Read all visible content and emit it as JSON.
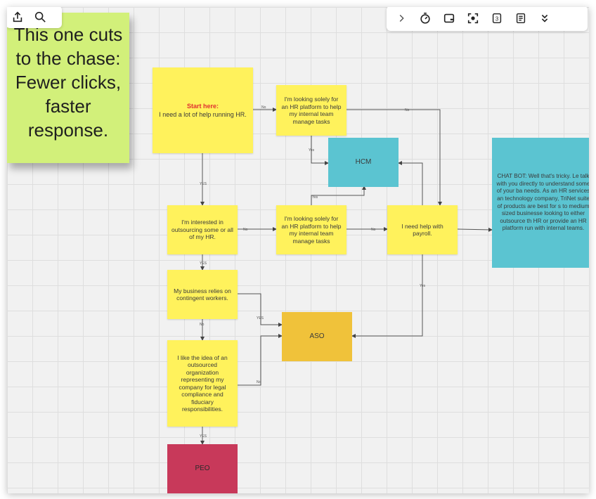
{
  "toolbar_left": {
    "icons": [
      "share-upload-icon",
      "search-icon"
    ]
  },
  "toolbar_right": {
    "icons": [
      "chevron-right-icon",
      "timer-icon",
      "card-add-icon",
      "focus-frame-icon",
      "count-icon",
      "notes-icon",
      "double-chevron-down-icon"
    ],
    "count_value": "3"
  },
  "colors": {
    "canvas": "#f1f1f1",
    "yellow": "#fff25c",
    "teal": "#5bc4d1",
    "orange": "#f0c23a",
    "crimson": "#c8395a",
    "green_note": "#d2f07a",
    "start_red": "#e03030"
  },
  "big_note": {
    "lines": [
      "This one cuts",
      "to the chase:",
      "Fewer clicks,",
      "faster",
      "response."
    ]
  },
  "nodes": {
    "start": {
      "prefix": "Start here:",
      "text": "I need a lot of help running HR."
    },
    "hr_platform_1": {
      "text": "I'm looking solely for an HR platform to help my internal team manage tasks"
    },
    "hcm": {
      "text": "HCM"
    },
    "outsourcing": {
      "text": "I'm interested in outsourcing some or all of my HR."
    },
    "hr_platform_2": {
      "text": "I'm looking solely for an HR platform to help my internal team manage tasks"
    },
    "payroll": {
      "text": "I need help with payroll."
    },
    "chatbot": {
      "text": "CHAT BOT: Well that's tricky. Le talk with you directly to understand some of your ba needs. As an HR services an technology company, TriNet suite of products are best for s to medium sized businesse looking to either outsource th HR or provide an HR platform run with internal teams."
    },
    "contingent": {
      "text": "My business relies on contingent workers."
    },
    "aso": {
      "text": "ASO"
    },
    "outsourced_org": {
      "text": "I like the idea of an outsourced organization representing my company for legal compliance and fiduciary responsibilities."
    },
    "peo": {
      "text": "PEO"
    }
  },
  "edge_labels": {
    "start_down": "YES",
    "start_right": "No",
    "platform1_down": "Yes",
    "platform2_up": "Yes",
    "outsourcing_right": "No",
    "platform2_right": "No",
    "outsourcing_down": "YES",
    "payroll_down": "Yes",
    "contingent_aso": "YES",
    "contingent_down": "No",
    "outsourced_aso": "No",
    "outsourced_down": "YES"
  }
}
